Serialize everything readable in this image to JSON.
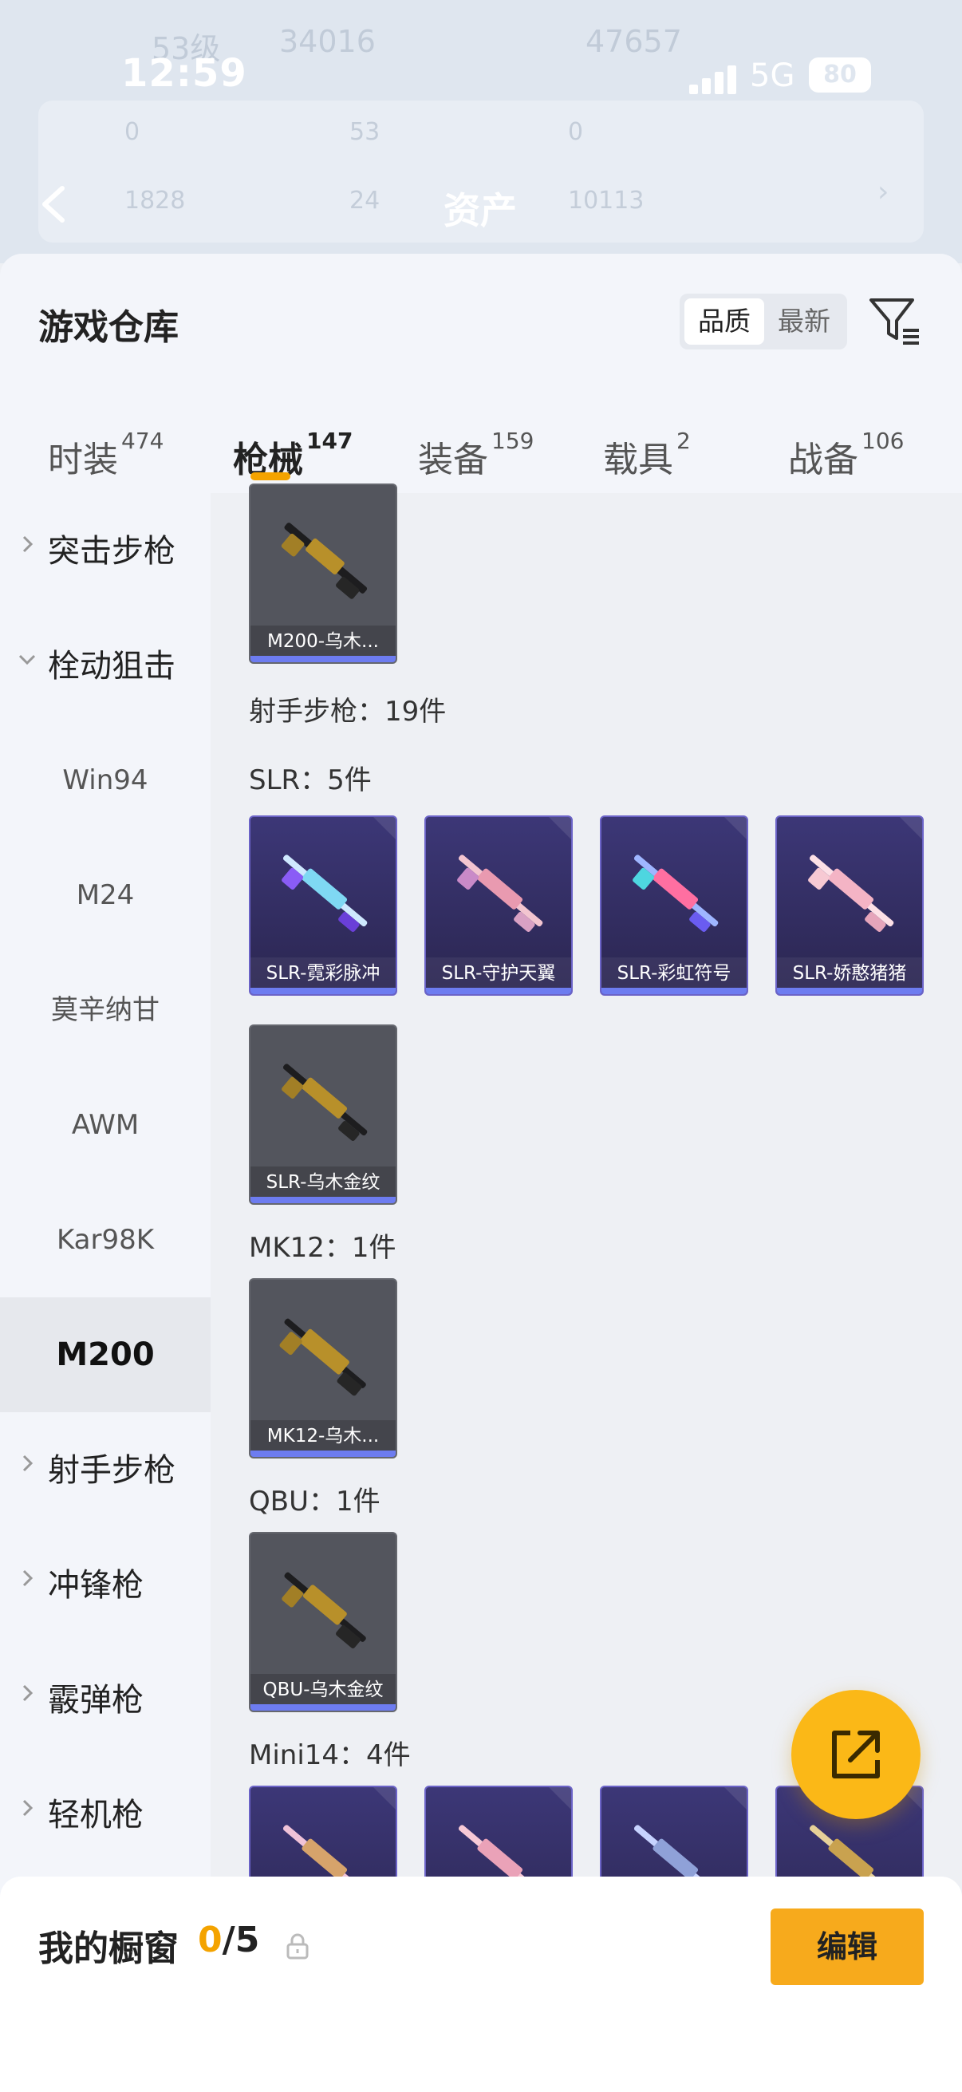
{
  "status": {
    "time": "12:59",
    "network": "5G",
    "battery": "80"
  },
  "background": {
    "level": "53级",
    "coins": "34016",
    "score": "47657",
    "stats": [
      "0",
      "53",
      "0",
      "1828",
      "24",
      "10113"
    ]
  },
  "nav": {
    "title": "资产"
  },
  "warehouse": {
    "title": "游戏仓库",
    "sort": {
      "quality": "品质",
      "latest": "最新"
    }
  },
  "tabs": [
    {
      "label": "时装",
      "count": "474"
    },
    {
      "label": "枪械",
      "count": "147"
    },
    {
      "label": "装备",
      "count": "159"
    },
    {
      "label": "载具",
      "count": "2"
    },
    {
      "label": "战备",
      "count": "106"
    }
  ],
  "sidebar": {
    "categories": {
      "assault": "突击步枪",
      "bolt": "栓动狙击",
      "marksman": "射手步枪",
      "smg": "冲锋枪",
      "shotgun": "霰弹枪",
      "lmg": "轻机枪"
    },
    "bolt_items": [
      "Win94",
      "M24",
      "莫辛纳甘",
      "AWM",
      "Kar98K",
      "M200"
    ]
  },
  "content": {
    "m200_card": "M200-乌木...",
    "marksman_summary": "射手步枪：19件",
    "slr_label": "SLR：5件",
    "slr_cards": [
      "SLR-霓彩脉冲",
      "SLR-守护天翼",
      "SLR-彩虹符号",
      "SLR-娇憨猪猪",
      "SLR-乌木金纹"
    ],
    "mk12_label": "MK12：1件",
    "mk12_card": "MK12-乌木...",
    "qbu_label": "QBU：1件",
    "qbu_card": "QBU-乌木金纹",
    "mini14_label": "Mini14：4件"
  },
  "showcase": {
    "title": "我的橱窗",
    "used": "0",
    "total": "/5",
    "edit": "编辑"
  },
  "colors": {
    "accent": "#f4a300",
    "button": "#f7aa1c",
    "card_bar": "#6d7cf0"
  },
  "icons": [
    "back-icon",
    "filter-icon",
    "chevron-right-icon",
    "chevron-down-icon",
    "share-icon",
    "lock-icon"
  ]
}
